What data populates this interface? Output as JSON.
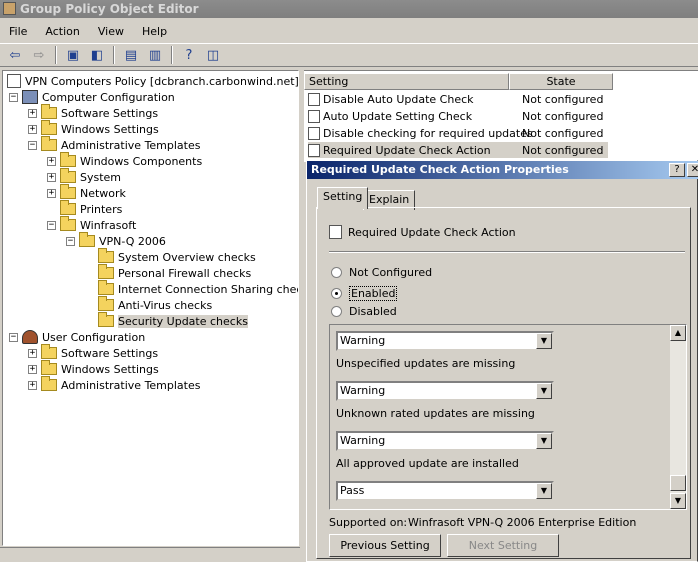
{
  "window": {
    "title": "Group Policy Object Editor"
  },
  "menu": [
    "File",
    "Action",
    "View",
    "Help"
  ],
  "tree": {
    "root": "VPN Computers Policy [dcbranch.carbonwind.net] Policy",
    "computer_config": "Computer Configuration",
    "software_settings": "Software Settings",
    "windows_settings": "Windows Settings",
    "admin_templates": "Administrative Templates",
    "windows_components": "Windows Components",
    "system": "System",
    "network": "Network",
    "printers": "Printers",
    "winfrasoft": "Winfrasoft",
    "vpnq": "VPN-Q 2006",
    "system_overview": "System Overview checks",
    "personal_firewall": "Personal Firewall checks",
    "ics": "Internet Connection Sharing checks",
    "antivirus": "Anti-Virus checks",
    "security_update": "Security Update checks",
    "user_config": "User Configuration",
    "user_software": "Software Settings",
    "user_windows": "Windows Settings",
    "user_admin": "Administrative Templates"
  },
  "list": {
    "col_setting": "Setting",
    "col_state": "State",
    "rows": [
      {
        "setting": "Disable Auto Update Check",
        "state": "Not configured"
      },
      {
        "setting": "Auto Update Setting Check",
        "state": "Not configured"
      },
      {
        "setting": "Disable checking for required updates",
        "state": "Not configured"
      },
      {
        "setting": "Required Update Check Action",
        "state": "Not configured"
      }
    ]
  },
  "dialog": {
    "title": "Required Update Check Action Properties",
    "help": "?",
    "close": "✕",
    "tab_setting": "Setting",
    "tab_explain": "Explain",
    "policy_name": "Required Update Check Action",
    "radio_not_configured": "Not Configured",
    "radio_enabled": "Enabled",
    "radio_disabled": "Disabled",
    "selected_radio": "Enabled",
    "combo1": "Warning",
    "label1": "Unspecified updates are missing",
    "combo2": "Warning",
    "label2": "Unknown rated updates are missing",
    "combo3": "Warning",
    "label3": "All approved update are installed",
    "combo4": "Pass",
    "supported_label": "Supported on:",
    "supported_value": "Winfrasoft VPN-Q 2006 Enterprise Edition",
    "prev_button": "Previous Setting",
    "next_button": "Next Setting"
  }
}
